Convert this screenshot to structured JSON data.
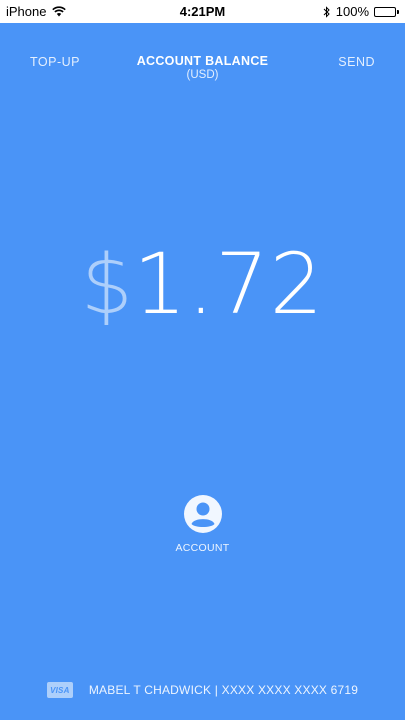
{
  "status_bar": {
    "carrier": "iPhone",
    "time": "4:21PM",
    "battery": "100%"
  },
  "nav": {
    "left_label": "TOP-UP",
    "title": "ACCOUNT BALANCE",
    "subtitle": "(USD)",
    "right_label": "SEND"
  },
  "balance": {
    "currency_symbol": "$",
    "amount": "1.72"
  },
  "account": {
    "label": "ACCOUNT",
    "icon": "user-icon"
  },
  "card": {
    "brand": "VISA",
    "holder": "MABEL T CHADWICK",
    "separator": "|",
    "number": "XXXX XXXX XXXX 6719"
  },
  "colors": {
    "background": "#4a94f7",
    "text": "#ffffff"
  }
}
